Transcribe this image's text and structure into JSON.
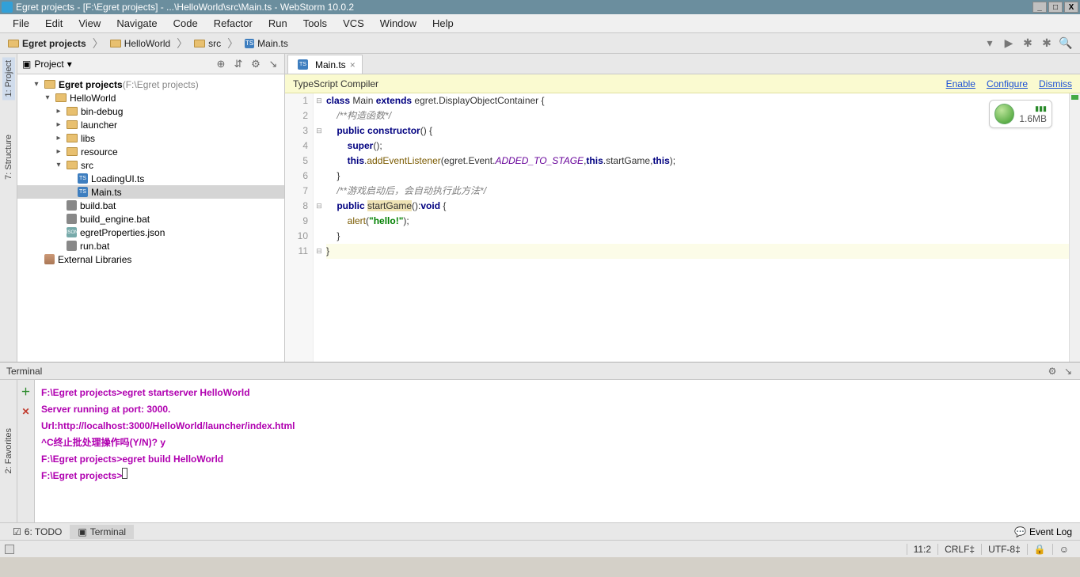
{
  "title_bar": "Egret projects - [F:\\Egret projects] - ...\\HelloWorld\\src\\Main.ts - WebStorm 10.0.2",
  "menu": [
    "File",
    "Edit",
    "View",
    "Navigate",
    "Code",
    "Refactor",
    "Run",
    "Tools",
    "VCS",
    "Window",
    "Help"
  ],
  "breadcrumbs": [
    {
      "icon": "folder",
      "label": "Egret projects"
    },
    {
      "icon": "folder",
      "label": "HelloWorld"
    },
    {
      "icon": "folder",
      "label": "src"
    },
    {
      "icon": "ts",
      "label": "Main.ts"
    }
  ],
  "left_tabs": [
    "1: Project",
    "7: Structure"
  ],
  "project_title": "Project",
  "tree": [
    {
      "pad": 0,
      "exp": "▾",
      "ic": "folder",
      "label": "Egret projects",
      "suffix": " (F:\\Egret projects)",
      "bold": true
    },
    {
      "pad": 14,
      "exp": "▾",
      "ic": "folder",
      "label": "HelloWorld"
    },
    {
      "pad": 28,
      "exp": "▸",
      "ic": "folder",
      "label": "bin-debug"
    },
    {
      "pad": 28,
      "exp": "▸",
      "ic": "folder",
      "label": "launcher"
    },
    {
      "pad": 28,
      "exp": "▸",
      "ic": "folder",
      "label": "libs"
    },
    {
      "pad": 28,
      "exp": "▸",
      "ic": "folder",
      "label": "resource"
    },
    {
      "pad": 28,
      "exp": "▾",
      "ic": "folder",
      "label": "src"
    },
    {
      "pad": 42,
      "exp": "",
      "ic": "ts",
      "label": "LoadingUI.ts"
    },
    {
      "pad": 42,
      "exp": "",
      "ic": "ts",
      "label": "Main.ts",
      "sel": true
    },
    {
      "pad": 28,
      "exp": "",
      "ic": "bat",
      "label": "build.bat"
    },
    {
      "pad": 28,
      "exp": "",
      "ic": "bat",
      "label": "build_engine.bat"
    },
    {
      "pad": 28,
      "exp": "",
      "ic": "json",
      "label": "egretProperties.json"
    },
    {
      "pad": 28,
      "exp": "",
      "ic": "bat",
      "label": "run.bat"
    },
    {
      "pad": 0,
      "exp": "",
      "ic": "lib",
      "label": "External Libraries"
    }
  ],
  "editor_tab": "Main.ts",
  "notice": {
    "title": "TypeScript Compiler",
    "links": [
      "Enable",
      "Configure",
      "Dismiss"
    ]
  },
  "badge_size": "1.6MB",
  "line_count": 11,
  "terminal_title": "Terminal",
  "terminal_lines": [
    "F:\\Egret projects>egret startserver HelloWorld",
    "Server running at port: 3000.",
    "Url:http://localhost:3000/HelloWorld/launcher/index.html",
    "^C终止批处理操作吗(Y/N)? y",
    "",
    "F:\\Egret projects>egret build HelloWorld",
    "",
    "F:\\Egret projects>"
  ],
  "fav_label": "2: Favorites",
  "bottom_tabs": [
    {
      "label": "6: TODO",
      "active": false
    },
    {
      "label": "Terminal",
      "active": true
    }
  ],
  "event_log": "Event Log",
  "status": {
    "pos": "11:2",
    "eol": "CRLF",
    "enc": "UTF-8"
  }
}
